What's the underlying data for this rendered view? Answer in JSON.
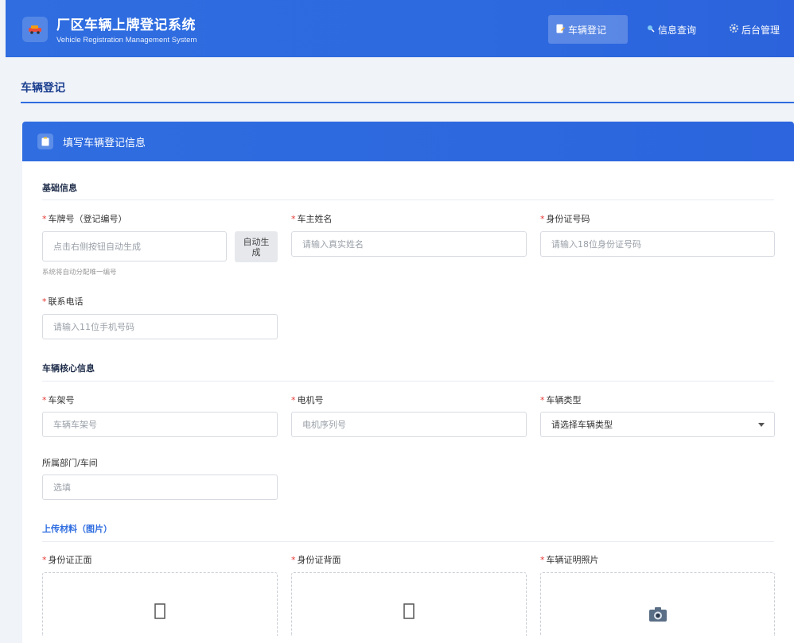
{
  "header": {
    "title": "厂区车辆上牌登记系统",
    "subtitle": "Vehicle Registration Management System",
    "nav": [
      {
        "label": "车辆登记",
        "icon": "edit-document-icon",
        "active": true
      },
      {
        "label": "信息查询",
        "icon": "search-icon",
        "active": false
      },
      {
        "label": "后台管理",
        "icon": "gear-icon",
        "active": false
      }
    ]
  },
  "page": {
    "title": "车辆登记"
  },
  "form": {
    "header": "填写车辆登记信息",
    "sections": {
      "basic": "基础信息",
      "vehicle": "车辆核心信息",
      "upload": "上传材料（图片）"
    },
    "fields": {
      "plate": {
        "label": "车牌号（登记编号）",
        "placeholder": "点击右侧按钮自动生成",
        "hint": "系统将自动分配唯一编号",
        "button": "自动生成"
      },
      "owner": {
        "label": "车主姓名",
        "placeholder": "请输入真实姓名"
      },
      "idcard": {
        "label": "身份证号码",
        "placeholder": "请输入18位身份证号码"
      },
      "phone": {
        "label": "联系电话",
        "placeholder": "请输入11位手机号码"
      },
      "frame": {
        "label": "车架号",
        "placeholder": "车辆车架号"
      },
      "motor": {
        "label": "电机号",
        "placeholder": "电机序列号"
      },
      "type": {
        "label": "车辆类型",
        "value": "请选择车辆类型"
      },
      "dept": {
        "label": "所属部门/车间",
        "placeholder": "选填"
      }
    },
    "uploads": [
      {
        "label": "身份证正面",
        "icon": "id-card-placeholder-icon"
      },
      {
        "label": "身份证背面",
        "icon": "id-card-placeholder-icon"
      },
      {
        "label": "车辆证明照片",
        "icon": "camera-icon"
      }
    ]
  },
  "colors": {
    "primary": "#2f6de0",
    "required": "#e53935"
  }
}
